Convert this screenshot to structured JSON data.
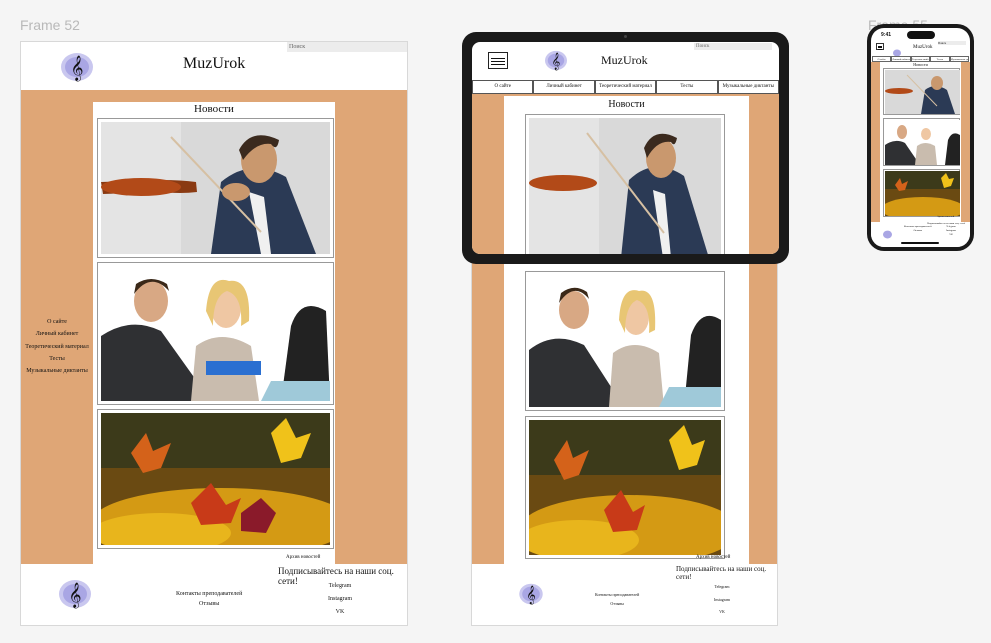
{
  "frames": {
    "desktop_label": "Frame 52",
    "phone_label": "Frame 55"
  },
  "site": {
    "brand": "MuzUrok",
    "search_placeholder": "Поиск",
    "news_title": "Новости",
    "archive_link": "Архив новостей",
    "nav": [
      "О сайте",
      "Личный кабинет",
      "Теоретический материал",
      "Тесты",
      "Музыкальные диктанты"
    ],
    "tablet_nav": [
      "О сайте",
      "Личный кабинет",
      "Теоретический материал",
      "Тесты",
      "Музыкальные диктанты"
    ],
    "footer": {
      "subscribe": "Подписывайтесь на наши соц. сети!",
      "contacts": "Контакты преподавателей",
      "reviews": "Отзывы",
      "social": [
        "Telegram",
        "Instagram",
        "VK"
      ]
    }
  },
  "phone": {
    "time": "9:41"
  },
  "images": [
    {
      "name": "violinist-photo"
    },
    {
      "name": "meeting-photo"
    },
    {
      "name": "autumn-leaves-photo"
    }
  ],
  "colors": {
    "accent": "#dfa676",
    "logo": "#c9c7ef"
  }
}
